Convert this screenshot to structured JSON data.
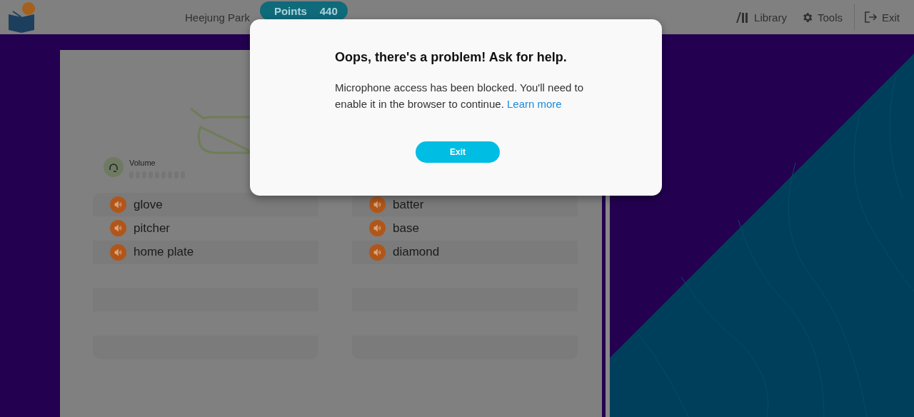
{
  "header": {
    "user_name": "Heejung Park",
    "points": {
      "label": "Points",
      "value": "440"
    },
    "nav": [
      {
        "kind": "library",
        "label": "Library"
      },
      {
        "kind": "tools",
        "label": "Tools"
      }
    ],
    "exit": "Exit"
  },
  "practice": {
    "volume": {
      "label": "Volume"
    },
    "word_columns": [
      [
        "glove",
        "pitcher",
        "home plate"
      ],
      [
        "batter",
        "base",
        "diamond"
      ]
    ]
  },
  "dialog": {
    "title": "Oops, there's a problem! Ask for help.",
    "message": "Microphone access has been blocked. You'll need to enable it in the browser to continue.",
    "link": "Learn more",
    "button": "Exit"
  }
}
